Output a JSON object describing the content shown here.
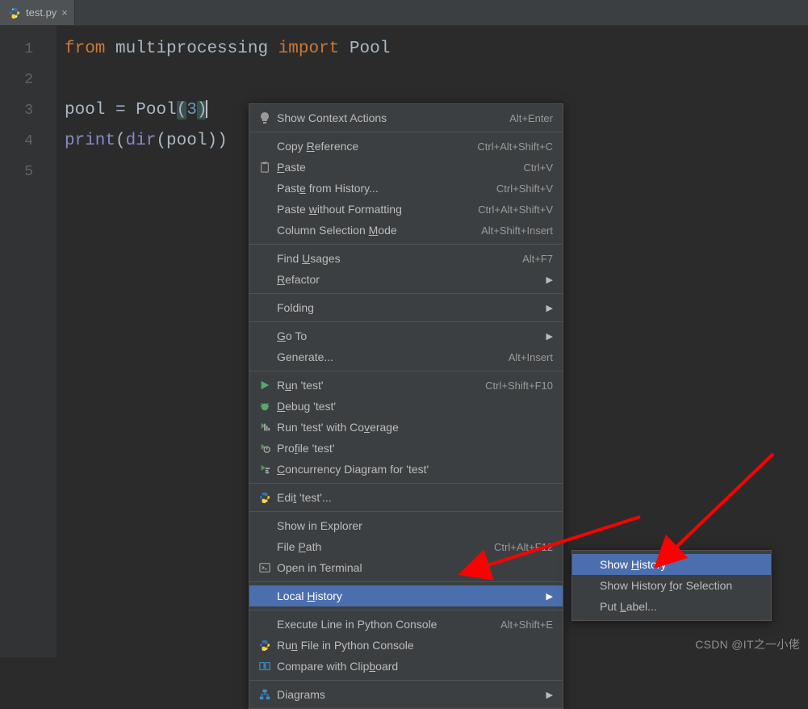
{
  "tab": {
    "filename": "test.py"
  },
  "gutter": [
    "1",
    "2",
    "3",
    "4",
    "5"
  ],
  "code": {
    "line1": {
      "kw1": "from",
      "mod": "multiprocessing",
      "kw2": "import",
      "cls": "Pool"
    },
    "line3": {
      "var": "pool",
      "eq": " = ",
      "cls": "Pool",
      "lp": "(",
      "num": "3",
      "rp": ")"
    },
    "line4": {
      "fn": "print",
      "lp": "(",
      "dir": "dir",
      "lp2": "(",
      "arg": "pool",
      "rp": "))"
    }
  },
  "menu": [
    {
      "icon": "bulb",
      "label": "Show Context Actions",
      "shortcut": "Alt+Enter"
    },
    {
      "sep": true
    },
    {
      "label": "Copy <u>R</u>eference",
      "shortcut": "Ctrl+Alt+Shift+C"
    },
    {
      "icon": "paste",
      "label": "<u>P</u>aste",
      "shortcut": "Ctrl+V"
    },
    {
      "label": "Past<u>e</u> from History...",
      "shortcut": "Ctrl+Shift+V"
    },
    {
      "label": "Paste <u>w</u>ithout Formatting",
      "shortcut": "Ctrl+Alt+Shift+V"
    },
    {
      "label": "Column Selection <u>M</u>ode",
      "shortcut": "Alt+Shift+Insert"
    },
    {
      "sep": true
    },
    {
      "label": "Find <u>U</u>sages",
      "shortcut": "Alt+F7"
    },
    {
      "label": "<u>R</u>efactor",
      "sub": true
    },
    {
      "sep": true
    },
    {
      "label": "Folding",
      "sub": true
    },
    {
      "sep": true
    },
    {
      "label": "<u>G</u>o To",
      "sub": true
    },
    {
      "label": "Generate...",
      "shortcut": "Alt+Insert"
    },
    {
      "sep": true
    },
    {
      "icon": "run",
      "label": "R<u>u</u>n 'test'",
      "shortcut": "Ctrl+Shift+F10"
    },
    {
      "icon": "debug",
      "label": "<u>D</u>ebug 'test'"
    },
    {
      "icon": "coverage",
      "label": "Run 'test' with Co<u>v</u>erage"
    },
    {
      "icon": "profile",
      "label": "Pro<u>f</u>ile 'test'"
    },
    {
      "icon": "concurrency",
      "label": "<u>C</u>oncurrency Diagram for 'test'"
    },
    {
      "sep": true
    },
    {
      "icon": "python",
      "label": "Edi<u>t</u> 'test'..."
    },
    {
      "sep": true
    },
    {
      "label": "Show in Explorer"
    },
    {
      "label": "File <u>P</u>ath",
      "shortcut": "Ctrl+Alt+F12"
    },
    {
      "icon": "terminal",
      "label": "Open in Terminal"
    },
    {
      "sep": true
    },
    {
      "label": "Local <u>H</u>istory",
      "sub": true,
      "highlight": true
    },
    {
      "sep": true
    },
    {
      "label": "Execute Line in Python Console",
      "shortcut": "Alt+Shift+E"
    },
    {
      "icon": "python",
      "label": "Ru<u>n</u> File in Python Console"
    },
    {
      "icon": "compare",
      "label": "Compare with Clip<u>b</u>oard"
    },
    {
      "sep": true
    },
    {
      "icon": "diagram",
      "label": "Diagrams",
      "sub": true
    }
  ],
  "submenu": [
    {
      "label": "Show <u>H</u>istory",
      "highlight": true
    },
    {
      "label": "Show History <u>f</u>or Selection"
    },
    {
      "label": "Put <u>L</u>abel..."
    }
  ],
  "watermark": "CSDN @IT之一小佬"
}
